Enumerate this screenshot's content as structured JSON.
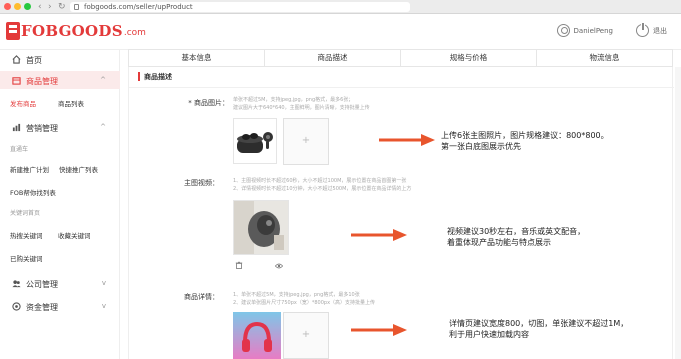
{
  "browser": {
    "url": "fobgoods.com/seller/upProduct",
    "colors": {
      "close": "#ff5f57",
      "minimize": "#febc2e",
      "zoom": "#28c840"
    }
  },
  "header": {
    "logo_text": "FOBGOODS",
    "logo_suffix": ".com",
    "user_name": "DanielPeng",
    "logout_label": "退出",
    "brand_color": "#e33a3a"
  },
  "sidebar": {
    "home": "首页",
    "product_mgmt": "商品管理",
    "publish": "发布商品",
    "product_list": "商品列表",
    "marketing": "营销管理",
    "direct_car": "直通车",
    "new_promo": "新建推广计划",
    "quick_promo": "快捷推广列表",
    "fob_keywords": "FOB帮你找列表",
    "keyword_mall": "关键词首页",
    "hot_keywords": "热搜关键词",
    "fav_keywords": "收藏关键词",
    "bought_keywords": "已购关键词",
    "company": "公司管理",
    "funds": "资金管理"
  },
  "tabs": [
    "基本信息",
    "商品描述",
    "规格与价格",
    "物流信息"
  ],
  "section": {
    "title": "商品描述"
  },
  "form": {
    "images_label": "* 商品图片：",
    "images_hint1": "单张不超过5M，支持jpeg,jpg，png格式，最多6张；",
    "images_hint2": "建议图片大于640*640，主图鲜明，图片清晰，支持批量上传",
    "video_label": "主图视频：",
    "video_hint1": "1、主图视频时长不超过60秒，大小不超过100M，展示位置在商品首图第一张",
    "video_hint2": "2、详情视频时长不超过10分钟，大小不超过500M，展示位置在商品详情的上方",
    "detail_label": "商品详情：",
    "detail_hint1": "1、单张不超过5M，支持jpeg,jpg，png格式，最多10张",
    "detail_hint2": "2、建议单张图片尺寸750px（宽）*800px（高）支持批量上传"
  },
  "notes": {
    "images_1": "上传6张主图照片，图片规格建议：800*800。",
    "images_2": "第一张白底图展示优先",
    "video_1": "视频建议30秒左右，音乐或英文配音，",
    "video_2": "着重体现产品功能与特点展示",
    "detail_1": "详情页建议宽度800，切图，单张建议不超过1M，",
    "detail_2": "利于用户快速加载内容"
  },
  "annotation_color": "#e8552d",
  "add_symbol": "+"
}
